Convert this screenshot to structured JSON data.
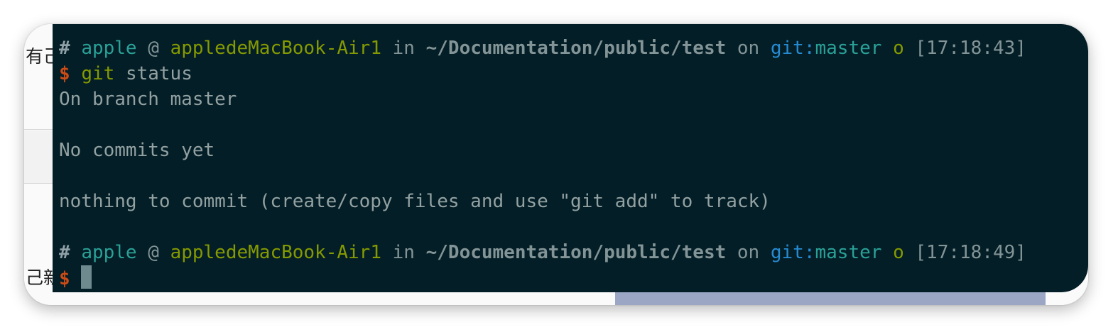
{
  "background_page": {
    "fragment_top": "有己",
    "fragment_bottom": "己新"
  },
  "terminal": {
    "prompts": [
      {
        "hash": "#",
        "user": "apple",
        "at": "@",
        "host": "appledeMacBook-Air1",
        "in": "in",
        "path": "~/Documentation/public/test",
        "on": "on",
        "git_label": "git:",
        "branch": "master",
        "dirty_flag": "o",
        "time": "[17:18:43]"
      },
      {
        "hash": "#",
        "user": "apple",
        "at": "@",
        "host": "appledeMacBook-Air1",
        "in": "in",
        "path": "~/Documentation/public/test",
        "on": "on",
        "git_label": "git:",
        "branch": "master",
        "dirty_flag": "o",
        "time": "[17:18:49]"
      }
    ],
    "prompt_symbol": "$",
    "command": {
      "program": "git",
      "args": "status"
    },
    "output": [
      "On branch master",
      "",
      "No commits yet",
      "",
      "nothing to commit (create/copy files and use \"git add\" to track)",
      ""
    ],
    "colors": {
      "background": "#031e27",
      "prompt_symbol": "#cb4b16",
      "user": "#2aa198",
      "host": "#859900",
      "git_label": "#268bd2"
    }
  }
}
